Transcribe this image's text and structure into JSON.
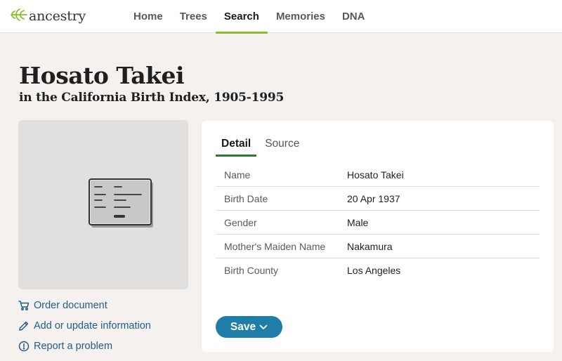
{
  "brand": {
    "name": "ancestry",
    "logo_icon": "leaf-icon",
    "accent": "#8bbd2d"
  },
  "nav": [
    {
      "label": "Home"
    },
    {
      "label": "Trees"
    },
    {
      "label": "Search",
      "active": true
    },
    {
      "label": "Memories"
    },
    {
      "label": "DNA"
    }
  ],
  "record": {
    "name": "Hosato Takei",
    "collection": "in the California Birth Index, 1905-1995"
  },
  "side_links": [
    {
      "icon": "cart-icon",
      "label": "Order document"
    },
    {
      "icon": "pencil-icon",
      "label": "Add or update information"
    },
    {
      "icon": "alert-icon",
      "label": "Report a problem"
    }
  ],
  "tabs": [
    {
      "label": "Detail",
      "active": true
    },
    {
      "label": "Source"
    }
  ],
  "details": [
    {
      "label": "Name",
      "value": "Hosato Takei"
    },
    {
      "label": "Birth Date",
      "value": "20 Apr 1937"
    },
    {
      "label": "Gender",
      "value": "Male"
    },
    {
      "label": "Mother's Maiden Name",
      "value": "Nakamura"
    },
    {
      "label": "Birth County",
      "value": "Los Angeles"
    }
  ],
  "actions": {
    "save_label": "Save",
    "save_color": "#1f7ea8"
  }
}
